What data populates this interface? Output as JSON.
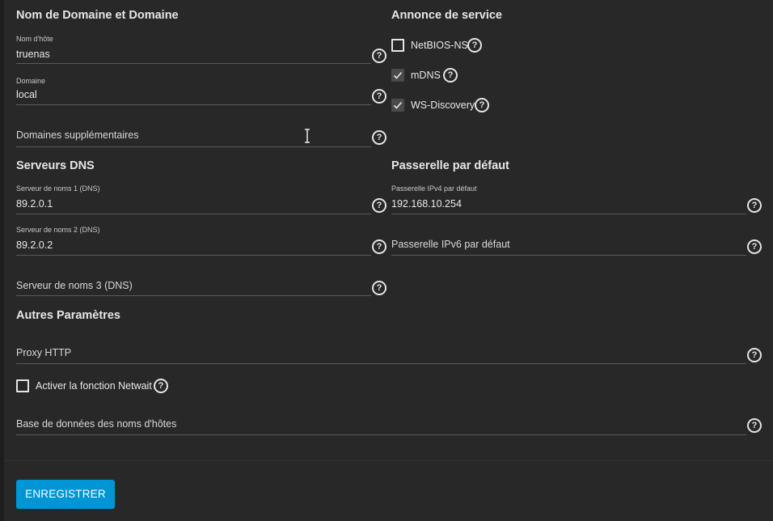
{
  "sections": {
    "hostname_domain": "Nom de Domaine et Domaine",
    "service_announcement": "Annonce de service",
    "dns_servers": "Serveurs DNS",
    "default_gateway": "Passerelle par défaut",
    "other_settings": "Autres Paramètres"
  },
  "fields": {
    "hostname": {
      "label": "Nom d'hôte",
      "value": "truenas"
    },
    "domain": {
      "label": "Domaine",
      "value": "local"
    },
    "additional_domains": {
      "placeholder": "Domaines supplémentaires"
    },
    "nameserver1": {
      "label": "Serveur de noms 1 (DNS)",
      "value": "89.2.0.1"
    },
    "nameserver2": {
      "label": "Serveur de noms 2 (DNS)",
      "value": "89.2.0.2"
    },
    "nameserver3": {
      "placeholder": "Serveur de noms 3 (DNS)"
    },
    "ipv4_gateway": {
      "label": "Passerelle IPv4 par défaut",
      "value": "192.168.10.254"
    },
    "ipv6_gateway": {
      "placeholder": "Passerelle IPv6 par défaut"
    },
    "http_proxy": {
      "placeholder": "Proxy HTTP"
    },
    "host_database": {
      "placeholder": "Base de données des noms d'hôtes"
    }
  },
  "checkboxes": {
    "netbios_ns": {
      "label": "NetBIOS-NS",
      "checked": false
    },
    "mdns": {
      "label": "mDNS",
      "checked": true
    },
    "ws_discovery": {
      "label": "WS-Discovery",
      "checked": true
    },
    "netwait": {
      "label": "Activer la fonction Netwait",
      "checked": false
    }
  },
  "help_glyph": "?",
  "icons": [
    "help-icon",
    "checkmark-icon",
    "text-cursor-icon"
  ],
  "colors": {
    "accent": "#0095d5",
    "background": "#282828"
  },
  "actions": {
    "save_label": "ENREGISTRER"
  }
}
